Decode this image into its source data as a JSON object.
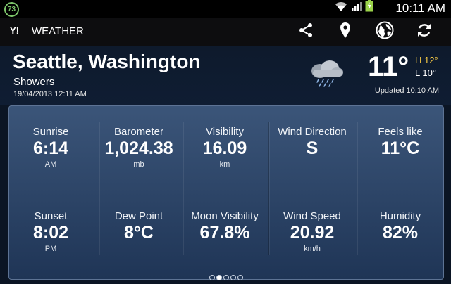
{
  "status_bar": {
    "notification_badge": "73",
    "time": "10:11 AM",
    "icons": [
      "wifi-icon",
      "signal-icon",
      "battery-charging-icon"
    ]
  },
  "app_bar": {
    "logo": "Y!",
    "title": "WEATHER",
    "actions": [
      "share-icon",
      "location-pin-icon",
      "globe-icon",
      "refresh-icon"
    ]
  },
  "location": {
    "city": "Seattle, Washington",
    "condition": "Showers",
    "datetime": "19/04/2013 12:11 AM"
  },
  "current": {
    "temperature": "11°",
    "high": "H 12°",
    "low": "L 10°",
    "updated": "Updated 10:10 AM"
  },
  "details": {
    "row1": [
      {
        "label": "Sunrise",
        "value": "6:14",
        "unit": "AM"
      },
      {
        "label": "Barometer",
        "value": "1,024.38",
        "unit": "mb"
      },
      {
        "label": "Visibility",
        "value": "16.09",
        "unit": "km"
      },
      {
        "label": "Wind Direction",
        "value": "S",
        "unit": ""
      },
      {
        "label": "Feels like",
        "value": "11°C",
        "unit": ""
      }
    ],
    "row2": [
      {
        "label": "Sunset",
        "value": "8:02",
        "unit": "PM"
      },
      {
        "label": "Dew Point",
        "value": "8°C",
        "unit": ""
      },
      {
        "label": "Moon Visibility",
        "value": "67.8%",
        "unit": ""
      },
      {
        "label": "Wind Speed",
        "value": "20.92",
        "unit": "km/h"
      },
      {
        "label": "Humidity",
        "value": "82%",
        "unit": ""
      }
    ]
  },
  "pager": {
    "count": 5,
    "active": 1
  },
  "colors": {
    "accent_high": "#f6c945",
    "panel": "#2d4568",
    "badge": "#7cc46a"
  }
}
